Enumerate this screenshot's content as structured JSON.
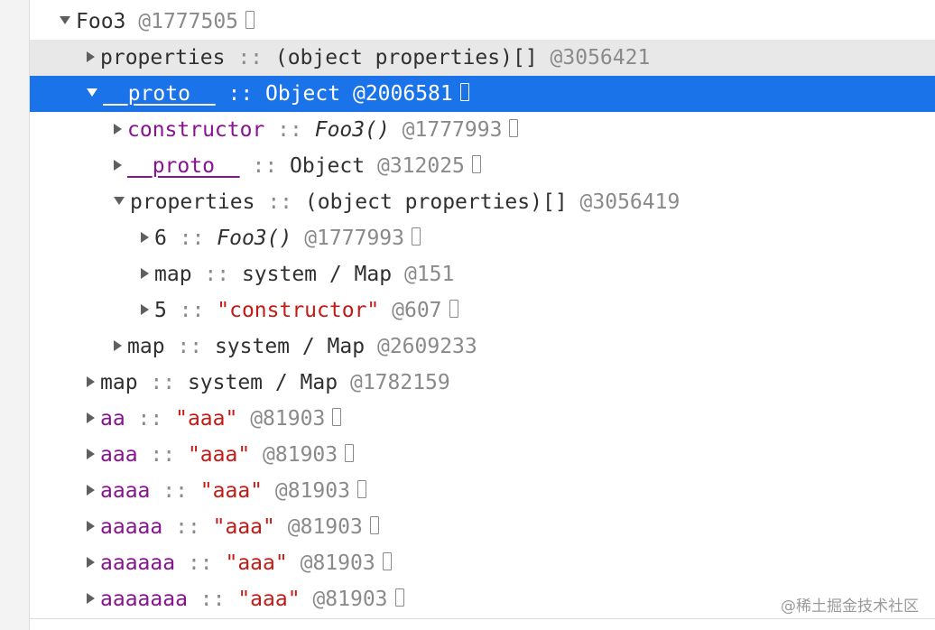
{
  "rows": [
    {
      "indent": 1,
      "expand": "down",
      "style": "normal",
      "name": "Foo3",
      "nameClass": "",
      "sep": "",
      "type": "",
      "typeClass": "",
      "id": "@1777505",
      "box": true
    },
    {
      "indent": 2,
      "expand": "right",
      "style": "hl",
      "name": "properties",
      "nameClass": "",
      "sep": " :: ",
      "type": "(object properties)[]",
      "typeClass": "",
      "id": "@3056421",
      "box": false
    },
    {
      "indent": 2,
      "expand": "down",
      "style": "sel",
      "name": "__proto__",
      "nameClass": "proto",
      "sep": " :: ",
      "type": "Object",
      "typeClass": "",
      "id": "@2006581",
      "box": true
    },
    {
      "indent": 3,
      "expand": "right",
      "style": "normal",
      "name": "constructor",
      "nameClass": "purple",
      "sep": " :: ",
      "type": "Foo3()",
      "typeClass": "italic",
      "id": "@1777993",
      "box": true
    },
    {
      "indent": 3,
      "expand": "right",
      "style": "normal",
      "name": "__proto__",
      "nameClass": "purple proto",
      "sep": " :: ",
      "type": "Object",
      "typeClass": "",
      "id": "@312025",
      "box": true
    },
    {
      "indent": 3,
      "expand": "down",
      "style": "normal",
      "name": "properties",
      "nameClass": "",
      "sep": " :: ",
      "type": "(object properties)[]",
      "typeClass": "",
      "id": "@3056419",
      "box": false
    },
    {
      "indent": 4,
      "expand": "right",
      "style": "normal",
      "name": "6",
      "nameClass": "",
      "sep": " :: ",
      "type": "Foo3()",
      "typeClass": "italic",
      "id": "@1777993",
      "box": true
    },
    {
      "indent": 4,
      "expand": "right",
      "style": "normal",
      "name": "map",
      "nameClass": "",
      "sep": " :: ",
      "type": "system / Map",
      "typeClass": "",
      "id": "@151",
      "box": false
    },
    {
      "indent": 4,
      "expand": "right",
      "style": "normal",
      "name": "5",
      "nameClass": "",
      "sep": " :: ",
      "type": "\"constructor\"",
      "typeClass": "str",
      "id": "@607",
      "box": true
    },
    {
      "indent": 3,
      "expand": "right",
      "style": "normal",
      "name": "map",
      "nameClass": "",
      "sep": " :: ",
      "type": "system / Map",
      "typeClass": "",
      "id": "@2609233",
      "box": false
    },
    {
      "indent": 2,
      "expand": "right",
      "style": "normal",
      "name": "map",
      "nameClass": "",
      "sep": " :: ",
      "type": "system / Map",
      "typeClass": "",
      "id": "@1782159",
      "box": false
    },
    {
      "indent": 2,
      "expand": "right",
      "style": "normal",
      "name": "aa",
      "nameClass": "purple",
      "sep": " :: ",
      "type": "\"aaa\"",
      "typeClass": "str",
      "id": "@81903",
      "box": true
    },
    {
      "indent": 2,
      "expand": "right",
      "style": "normal",
      "name": "aaa",
      "nameClass": "purple",
      "sep": " :: ",
      "type": "\"aaa\"",
      "typeClass": "str",
      "id": "@81903",
      "box": true
    },
    {
      "indent": 2,
      "expand": "right",
      "style": "normal",
      "name": "aaaa",
      "nameClass": "purple",
      "sep": " :: ",
      "type": "\"aaa\"",
      "typeClass": "str",
      "id": "@81903",
      "box": true
    },
    {
      "indent": 2,
      "expand": "right",
      "style": "normal",
      "name": "aaaaa",
      "nameClass": "purple",
      "sep": " :: ",
      "type": "\"aaa\"",
      "typeClass": "str",
      "id": "@81903",
      "box": true
    },
    {
      "indent": 2,
      "expand": "right",
      "style": "normal",
      "name": "aaaaaa",
      "nameClass": "purple",
      "sep": " :: ",
      "type": "\"aaa\"",
      "typeClass": "str",
      "id": "@81903",
      "box": true
    },
    {
      "indent": 2,
      "expand": "right",
      "style": "normal",
      "name": "aaaaaaa",
      "nameClass": "purple",
      "sep": " :: ",
      "type": "\"aaa\"",
      "typeClass": "str",
      "id": "@81903",
      "box": true
    }
  ],
  "watermark": "@稀土掘金技术社区",
  "colors": {
    "selection": "#1a73e8",
    "hover": "#e8e8e8",
    "property_purple": "#881391",
    "string_red": "#c41a16",
    "id_gray": "#8a8a8a"
  }
}
